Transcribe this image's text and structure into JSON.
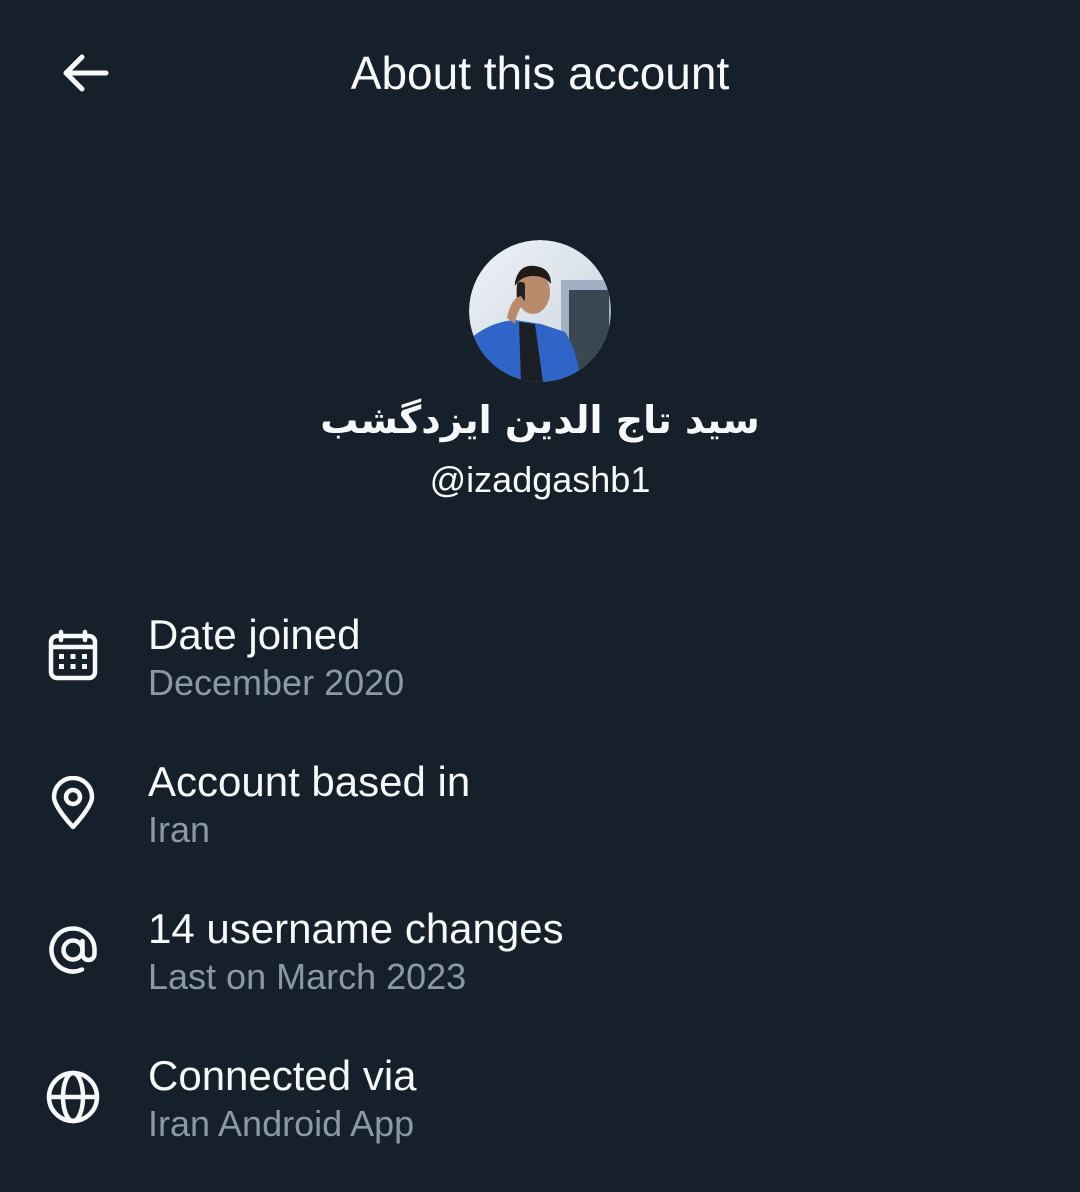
{
  "header": {
    "title": "About this account",
    "back_icon": "arrow-left-icon"
  },
  "profile": {
    "display_name": "سید تاج الدین ایزدگشب",
    "handle": "@izadgashb1"
  },
  "info": [
    {
      "icon": "calendar-icon",
      "title": "Date joined",
      "subtitle": "December 2020"
    },
    {
      "icon": "location-pin-icon",
      "title": "Account based in",
      "subtitle": "Iran"
    },
    {
      "icon": "at-sign-icon",
      "title": "14 username changes",
      "subtitle": "Last on March 2023"
    },
    {
      "icon": "globe-icon",
      "title": "Connected via",
      "subtitle": "Iran Android App"
    }
  ],
  "colors": {
    "background": "#15202b",
    "text_primary": "#f7f9f9",
    "text_secondary": "#8b98a5"
  }
}
